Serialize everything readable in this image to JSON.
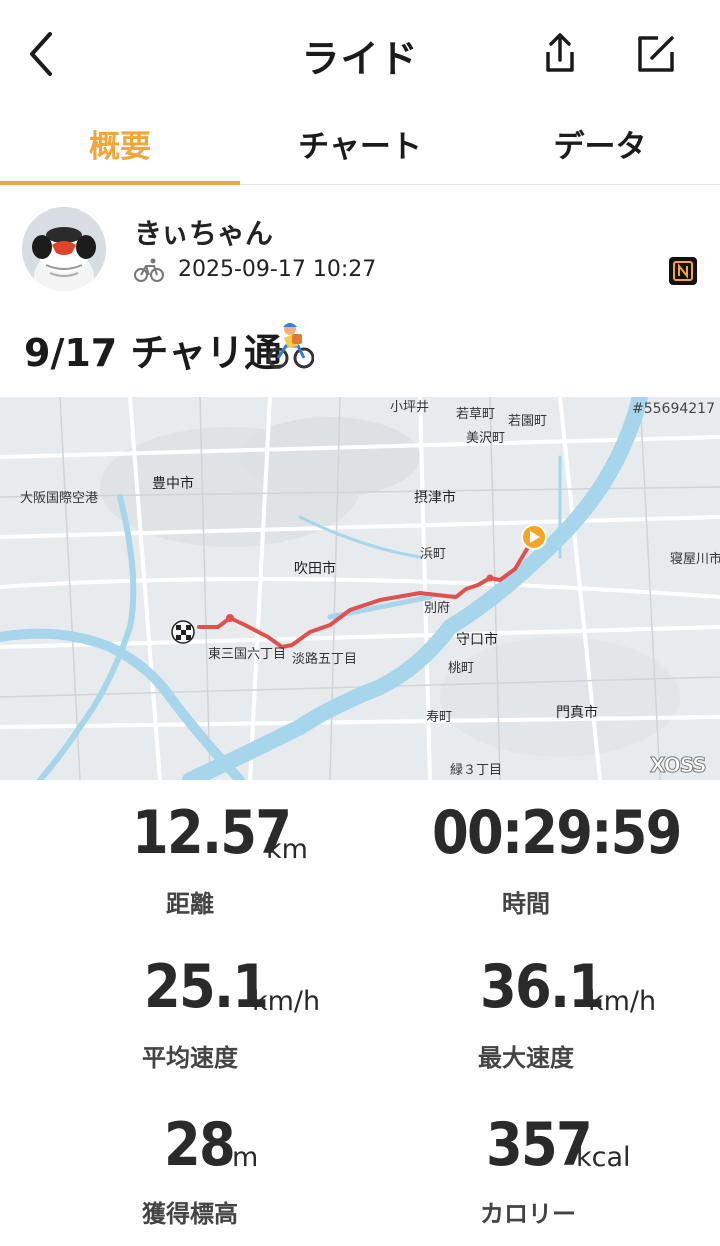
{
  "header": {
    "title": "ライド"
  },
  "tabs": [
    {
      "label": "概要"
    },
    {
      "label": "チャート"
    },
    {
      "label": "データ"
    }
  ],
  "profile": {
    "name": "きぃちゃん",
    "datetime": "2025-09-17 10:27"
  },
  "ride": {
    "title": "9/17 チャリ通"
  },
  "map": {
    "id": "#55694217",
    "brand": "XOSS",
    "labels": [
      "大阪国際空港",
      "豊中市",
      "吹田市",
      "摂津市",
      "浜町",
      "別府",
      "守口市",
      "桃町",
      "寿町",
      "門真市",
      "寝屋川市",
      "緑３丁目",
      "東三国六丁目",
      "淡路五丁目",
      "小坪井",
      "若草町",
      "若園町",
      "美沢町"
    ],
    "route_color": "#e0504e",
    "start_color": "#f5a623"
  },
  "stats": [
    {
      "value": "12.57",
      "unit": "km",
      "label": "距離"
    },
    {
      "value": "00:29:59",
      "unit": "",
      "label": "時間"
    },
    {
      "value": "25.1",
      "unit": "km/h",
      "label": "平均速度"
    },
    {
      "value": "36.1",
      "unit": "km/h",
      "label": "最大速度"
    },
    {
      "value": "28",
      "unit": "m",
      "label": "獲得標高"
    },
    {
      "value": "357",
      "unit": "kcal",
      "label": "カロリー"
    }
  ],
  "colors": {
    "accent": "#f2a53a",
    "river": "#9fd2ea"
  }
}
